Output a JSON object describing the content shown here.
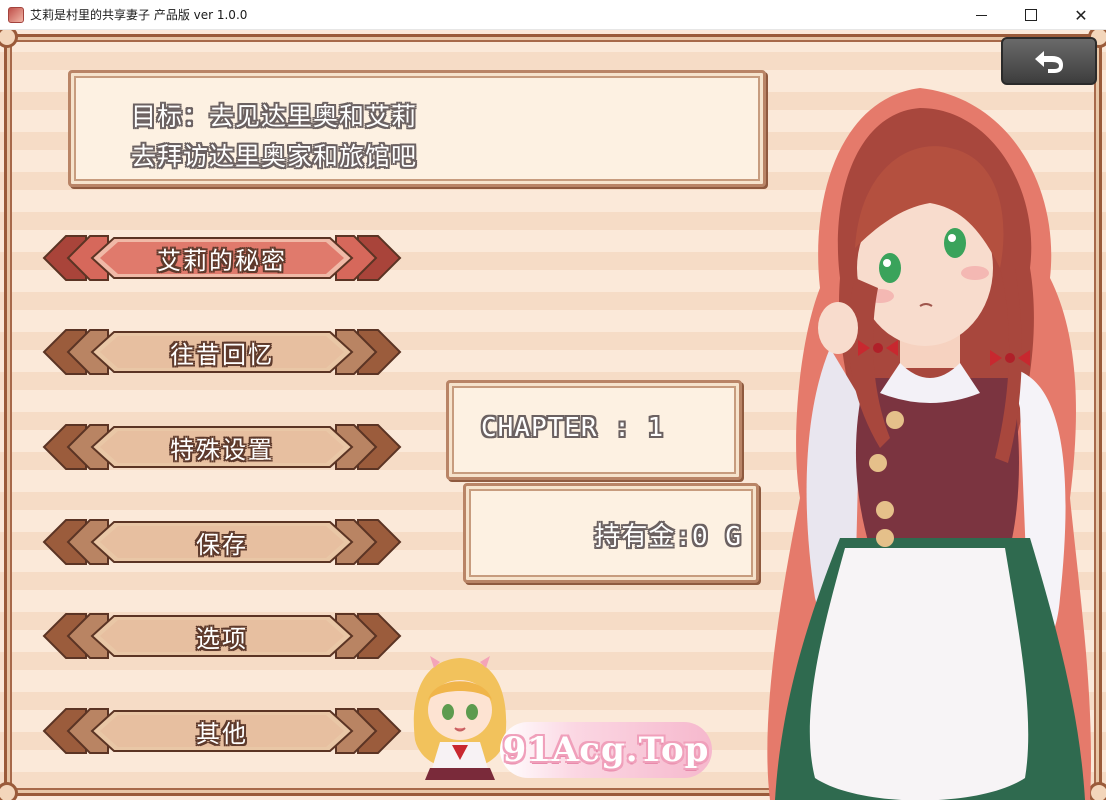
{
  "window": {
    "title": "艾莉是村里的共享妻子 产品版 ver 1.0.0",
    "close_glyph": "✕"
  },
  "objective": {
    "line1": "目标：去见达里奥和艾莉",
    "line2": "去拜访达里奥家和旅馆吧"
  },
  "menu": {
    "items": [
      {
        "label": "艾莉的秘密",
        "selected": true
      },
      {
        "label": "往昔回忆",
        "selected": false
      },
      {
        "label": "特殊设置",
        "selected": false
      },
      {
        "label": "保存",
        "selected": false
      },
      {
        "label": "选项",
        "selected": false
      },
      {
        "label": "其他",
        "selected": false
      }
    ]
  },
  "status": {
    "chapter": "CHAPTER : 1",
    "gold": "持有金:0 G"
  },
  "back_button": {
    "icon": "return-arrow-icon"
  },
  "watermark": {
    "text": "91Acg.Top"
  },
  "colors": {
    "button_brown": "#b07d5a",
    "button_selected": "#d9665a",
    "panel_bg": "#fdf1e2",
    "frame": "#9a5b3a"
  }
}
